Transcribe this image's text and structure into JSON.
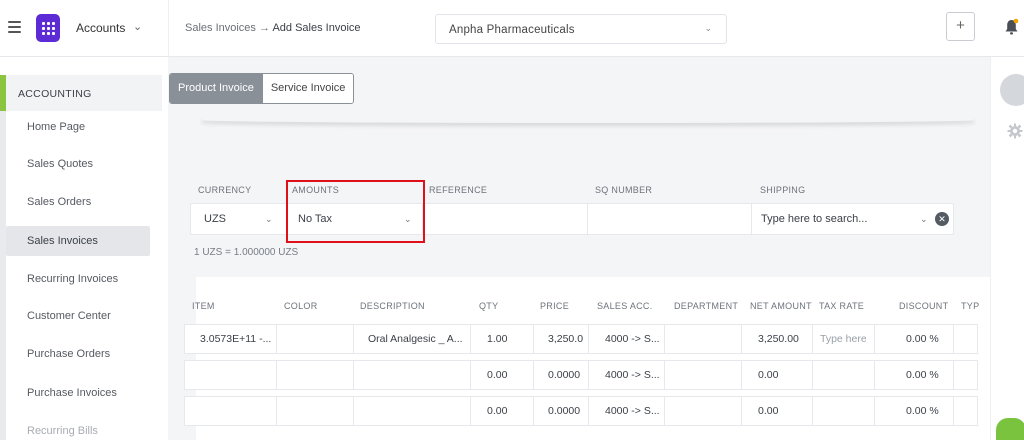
{
  "header": {
    "app_name": "Accounts",
    "breadcrumb_parent": "Sales Invoices",
    "breadcrumb_sep": "→",
    "breadcrumb_current": "Add Sales Invoice",
    "company": "Anpha Pharmaceuticals",
    "add_label": "+"
  },
  "colors": {
    "brand": "#5c2bd6",
    "accent_green": "#8ac440",
    "highlight_red": "#e0101a"
  },
  "sidebar": {
    "section": "ACCOUNTING",
    "items": [
      {
        "label": "Home Page"
      },
      {
        "label": "Sales Quotes"
      },
      {
        "label": "Sales Orders"
      },
      {
        "label": "Sales Invoices",
        "active": true
      },
      {
        "label": "Recurring Invoices"
      },
      {
        "label": "Customer Center"
      },
      {
        "label": "Purchase Orders"
      },
      {
        "label": "Purchase Invoices"
      },
      {
        "label": "Recurring Bills"
      }
    ]
  },
  "invoice_type": {
    "product": "Product Invoice",
    "service": "Service Invoice",
    "selected": "product"
  },
  "form": {
    "currency_label": "CURRENCY",
    "currency_value": "UZS",
    "amounts_label": "AMOUNTS",
    "amounts_value": "No Tax",
    "reference_label": "REFERENCE",
    "sq_label": "SQ NUMBER",
    "shipping_label": "SHIPPING",
    "shipping_placeholder": "Type here to search...",
    "rate_text": "1 UZS = 1.000000 UZS"
  },
  "table": {
    "headers": [
      "ITEM",
      "COLOR",
      "DESCRIPTION",
      "QTY",
      "PRICE",
      "SALES ACC.",
      "DEPARTMENT",
      "NET AMOUNT",
      "TAX RATE",
      "DISCOUNT",
      "TYP"
    ],
    "rows": [
      {
        "item": "3.0573E+11 -...",
        "color": "",
        "description": "Oral Analgesic _ A...",
        "qty": "1.00",
        "price": "3,250.0",
        "sales_acc": "4000 -> S...",
        "department": "",
        "net_amount": "3,250.00",
        "tax_rate": "Type here",
        "discount": "0.00 %"
      },
      {
        "item": "",
        "color": "",
        "description": "",
        "qty": "0.00",
        "price": "0.0000",
        "sales_acc": "4000 -> S...",
        "department": "",
        "net_amount": "0.00",
        "tax_rate": "",
        "discount": "0.00 %"
      },
      {
        "item": "",
        "color": "",
        "description": "",
        "qty": "0.00",
        "price": "0.0000",
        "sales_acc": "4000 -> S...",
        "department": "",
        "net_amount": "0.00",
        "tax_rate": "",
        "discount": "0.00 %"
      }
    ]
  }
}
